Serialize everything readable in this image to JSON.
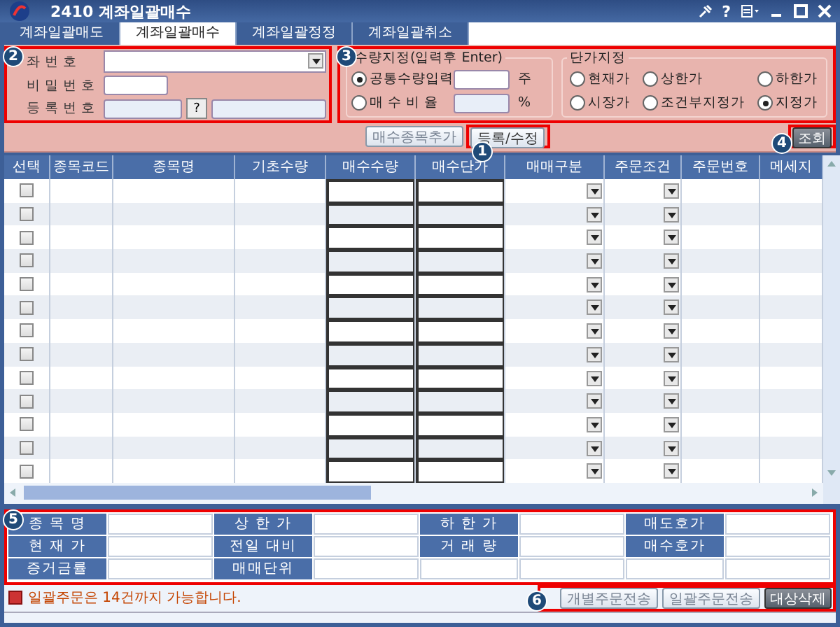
{
  "window": {
    "title": "2410 계좌일괄매수",
    "help": "?"
  },
  "tabs": [
    {
      "label": "계좌일괄매도",
      "selected": false
    },
    {
      "label": "계좌일괄매수",
      "selected": true
    },
    {
      "label": "계좌일괄정정",
      "selected": false
    },
    {
      "label": "계좌일괄취소",
      "selected": false
    }
  ],
  "account": {
    "badge": "2",
    "account_label": "좌 번 호",
    "password_label": "비 밀 번 호",
    "register_label": "등 록 번 호",
    "lookup": "?"
  },
  "quantity": {
    "badge": "3",
    "title": "수량지정(입력후 Enter)",
    "options": [
      {
        "label": "공통수량입력",
        "selected": true,
        "unit": "주",
        "kind": "input"
      },
      {
        "label": "매 수 비 율",
        "selected": false,
        "unit": "%",
        "kind": "disabled"
      }
    ]
  },
  "price": {
    "title": "단가지정",
    "options": [
      {
        "label": "현재가",
        "selected": false
      },
      {
        "label": "상한가",
        "selected": false
      },
      {
        "label": "하한가",
        "selected": false
      },
      {
        "label": "시장가",
        "selected": false
      },
      {
        "label": "조건부지정가",
        "selected": false
      },
      {
        "label": "지정가",
        "selected": true
      }
    ]
  },
  "actions": {
    "add": "매수종목추가",
    "register": "등록/수정",
    "register_badge": "1",
    "query": "조회",
    "query_badge": "4"
  },
  "table": {
    "columns": [
      "선택",
      "종목코드",
      "종목명",
      "기초수량",
      "매수수량",
      "매수단가",
      "매매구분",
      "주문조건",
      "주문번호",
      "메세지"
    ],
    "rows": [
      {
        "checked": false
      },
      {
        "checked": false
      },
      {
        "checked": false
      },
      {
        "checked": false
      },
      {
        "checked": false
      },
      {
        "checked": false
      },
      {
        "checked": false
      },
      {
        "checked": false
      },
      {
        "checked": false
      },
      {
        "checked": false
      },
      {
        "checked": false
      },
      {
        "checked": false
      },
      {
        "checked": false
      }
    ]
  },
  "info": {
    "badge": "5",
    "rows": [
      [
        "종 목 명",
        "상 한 가",
        "하 한 가",
        "매도호가"
      ],
      [
        "현 재 가",
        "전일 대비",
        "거 래 량",
        "매수호가"
      ],
      [
        "증거금률",
        "매매단위"
      ]
    ]
  },
  "footer": {
    "notice": "일괄주문은 14건까지 가능합니다.",
    "badge": "6",
    "buttons": [
      {
        "label": "개별주문전송",
        "kind": "light"
      },
      {
        "label": "일괄주문전송",
        "kind": "light"
      },
      {
        "label": "대상삭제",
        "kind": "dark"
      }
    ]
  }
}
